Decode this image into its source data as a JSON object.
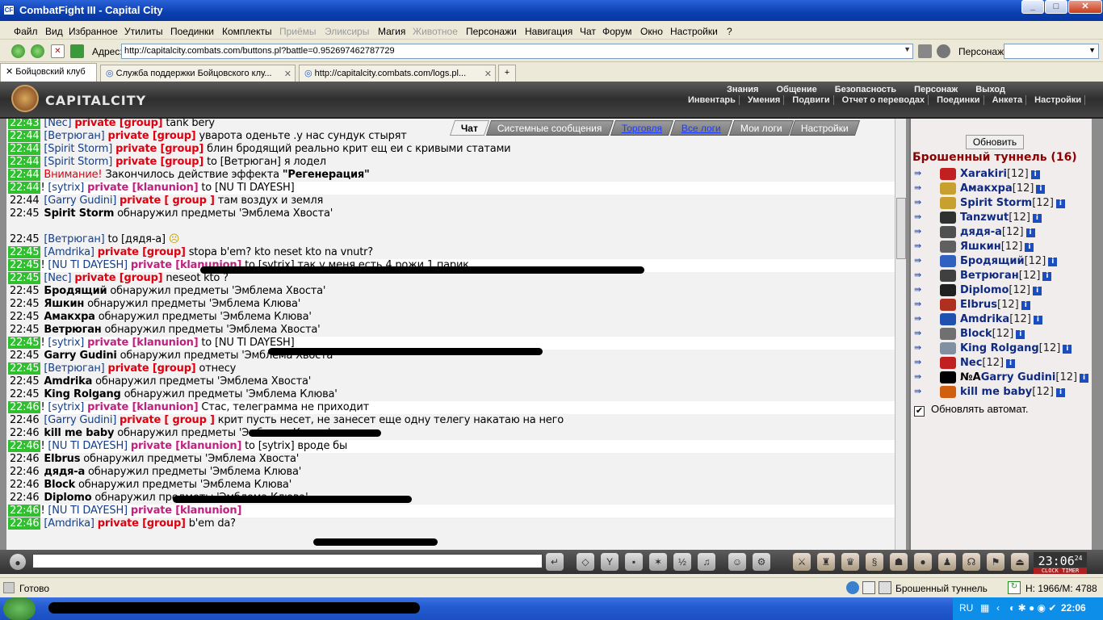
{
  "window": {
    "title": "CombatFight III - Capital City"
  },
  "menu": {
    "items": [
      "Файл",
      "Вид",
      "Избранное",
      "Утилиты",
      "Поединки",
      "Комплекты",
      "Приёмы",
      "Эликсиры",
      "Магия",
      "Животное",
      "Персонажи",
      "Навигация",
      "Чат",
      "Форум",
      "Окно",
      "Настройки",
      "?"
    ]
  },
  "address": {
    "label": "Адрес:",
    "url": "http://capitalcity.combats.com/buttons.pl?battle=0.952697462787729",
    "person_label": "Персонаж:"
  },
  "tabs": [
    {
      "label": "Бойцовский клуб"
    },
    {
      "label": "Служба поддержки Бойцовского клу..."
    },
    {
      "label": "http://capitalcity.combats.com/logs.pl..."
    }
  ],
  "game": {
    "logo_text": "CAPITALCITY",
    "top_menu": [
      "Знания",
      "Общение",
      "Безопасность",
      "Персонаж",
      "Выход"
    ],
    "sub_menu": [
      "Инвентарь",
      "Умения",
      "Подвиги",
      "Отчет о переводах",
      "Поединки",
      "Анкета",
      "Настройки"
    ],
    "chat_tabs": [
      "Чат",
      "Системные сообщения",
      "Торговля",
      "Все логи",
      "Мои логи",
      "Настройки"
    ]
  },
  "chat": {
    "lines": [
      {
        "time": "22:43",
        "hl": true,
        "w": false,
        "n": "[Nec]",
        "p": "private [group]",
        "m": "tank bery"
      },
      {
        "time": "22:44",
        "hl": true,
        "w": false,
        "n": "[Ветрюган]",
        "p": "private [group]",
        "m": "уварота оденьте .у нас сундук стырят"
      },
      {
        "time": "22:44",
        "hl": true,
        "w": false,
        "n": "[Spirit Storm]",
        "p": "private [group]",
        "m": "блин бродящий реально крит ещ еи с кривыми статами"
      },
      {
        "time": "22:44",
        "hl": true,
        "w": false,
        "n": "[Spirit Storm]",
        "p": "private [group]",
        "m": "to [Ветрюган] я лодел"
      },
      {
        "time": "22:44",
        "hl": true,
        "w": false,
        "warn": "Внимание!",
        "m": "Закончилось действие эффекта ",
        "mb": "\"Регенерация\""
      },
      {
        "time": "22:44",
        "hl": true,
        "w": true,
        "x": "!",
        "n": "[sytrix]",
        "pk": "private [klanunion]",
        "m": "to [NU TI DAYESH]"
      },
      {
        "time": "22:44",
        "hl": false,
        "w": false,
        "n": "[Garry Gudini]",
        "p": "private [ group ]",
        "m": "там воздух и земля"
      },
      {
        "time": "22:45",
        "hl": false,
        "w": false,
        "b": "Spirit Storm",
        "m": "обнаружил предметы 'Эмблема Хвоста'"
      },
      {
        "time": "",
        "hl": false,
        "w": false,
        "m": ""
      },
      {
        "time": "22:45",
        "hl": false,
        "w": false,
        "n": "[Ветрюган]",
        "m": "to [дядя-а]",
        "smile": true
      },
      {
        "time": "22:45",
        "hl": true,
        "w": false,
        "n": "[Amdrika]",
        "p": "private [group]",
        "m": "stopa b'em? kto neset kto na vnutr?"
      },
      {
        "time": "22:45",
        "hl": true,
        "w": true,
        "x": "!",
        "n": "[NU TI DAYESH]",
        "pk": "private [klanunion]",
        "m": "to [sytrix] так у меня есть 4 рожи 1 парик"
      },
      {
        "time": "22:45",
        "hl": true,
        "w": false,
        "n": "[Nec]",
        "p": "private [group]",
        "m": "neseot kto ?"
      },
      {
        "time": "22:45",
        "hl": false,
        "w": false,
        "b": "Бродящий",
        "m": "обнаружил предметы 'Эмблема Хвоста'"
      },
      {
        "time": "22:45",
        "hl": false,
        "w": false,
        "b": "Яшкин",
        "m": "обнаружил предметы 'Эмблема Клюва'"
      },
      {
        "time": "22:45",
        "hl": false,
        "w": false,
        "b": "Амакхра",
        "m": "обнаружил предметы 'Эмблема Клюва'"
      },
      {
        "time": "22:45",
        "hl": false,
        "w": false,
        "b": "Ветрюган",
        "m": "обнаружил предметы 'Эмблема Хвоста'"
      },
      {
        "time": "22:45",
        "hl": true,
        "w": true,
        "x": "!",
        "n": "[sytrix]",
        "pk": "private [klanunion]",
        "m": "to [NU TI DAYESH]"
      },
      {
        "time": "22:45",
        "hl": false,
        "w": false,
        "b": "Garry Gudini",
        "m": "обнаружил предметы 'Эмблема Хвоста'"
      },
      {
        "time": "22:45",
        "hl": true,
        "w": false,
        "n": "[Ветрюган]",
        "p": "private [group]",
        "m": "отнесу"
      },
      {
        "time": "22:45",
        "hl": false,
        "w": false,
        "b": "Amdrika",
        "m": "обнаружил предметы 'Эмблема Хвоста'"
      },
      {
        "time": "22:45",
        "hl": false,
        "w": false,
        "b": "King Rolgang",
        "m": "обнаружил предметы 'Эмблема Клюва'"
      },
      {
        "time": "22:46",
        "hl": true,
        "w": true,
        "x": "!",
        "n": "[sytrix]",
        "pk": "private [klanunion]",
        "m": "Стас, телеграмма не приходит"
      },
      {
        "time": "22:46",
        "hl": false,
        "w": false,
        "n": "[Garry Gudini]",
        "p": "private [ group ]",
        "m": "крит пусть несет, не занесет еще одну телегу накатаю на него"
      },
      {
        "time": "22:46",
        "hl": false,
        "w": false,
        "b": "kill me baby",
        "m": "обнаружил предметы 'Эмблема Клюва'"
      },
      {
        "time": "22:46",
        "hl": true,
        "w": true,
        "x": "!",
        "n": "[NU TI DAYESH]",
        "pk": "private [klanunion]",
        "m": "to [sytrix] вроде бы"
      },
      {
        "time": "22:46",
        "hl": false,
        "w": false,
        "b": "Elbrus",
        "m": "обнаружил предметы 'Эмблема Хвоста'"
      },
      {
        "time": "22:46",
        "hl": false,
        "w": false,
        "b": "дядя-а",
        "m": "обнаружил предметы 'Эмблема Клюва'"
      },
      {
        "time": "22:46",
        "hl": false,
        "w": false,
        "b": "Block",
        "m": "обнаружил предметы 'Эмблема Клюва'"
      },
      {
        "time": "22:46",
        "hl": false,
        "w": false,
        "b": "Diplomo",
        "m": "обнаружил предметы 'Эмблема Клюва'"
      },
      {
        "time": "22:46",
        "hl": true,
        "w": true,
        "x": "!",
        "n": "[NU TI DAYESH]",
        "pk": "private [klanunion]",
        "m": ""
      },
      {
        "time": "22:46",
        "hl": true,
        "w": false,
        "n": "[Amdrika]",
        "p": "private [group]",
        "m": "b'em da?"
      }
    ]
  },
  "panel": {
    "refresh_label": "Обновить",
    "room_title": "Брошенный туннель (16)",
    "players": [
      {
        "name": "Xarakiri",
        "level": "[12]",
        "color": "#c22020"
      },
      {
        "name": "Амакхра",
        "level": "[12]",
        "color": "#c8a030"
      },
      {
        "name": "Spirit Storm",
        "level": "[12]",
        "color": "#c8a030"
      },
      {
        "name": "Tanzwut",
        "level": "[12]",
        "color": "#303030"
      },
      {
        "name": "дядя-а",
        "level": "[12]",
        "color": "#505050"
      },
      {
        "name": "Яшкин",
        "level": "[12]",
        "color": "#606060"
      },
      {
        "name": "Бродящий",
        "level": "[12]",
        "color": "#3060c0"
      },
      {
        "name": "Ветрюган",
        "level": "[12]",
        "color": "#404040"
      },
      {
        "name": "Diplomo",
        "level": "[12]",
        "color": "#202020"
      },
      {
        "name": "Elbrus",
        "level": "[12]",
        "color": "#b03020"
      },
      {
        "name": "Amdrika",
        "level": "[12]",
        "color": "#2050b0"
      },
      {
        "name": "Block",
        "level": "[12]",
        "color": "#707070"
      },
      {
        "name": "King Rolgang",
        "level": "[12]",
        "color": "#8090a0"
      },
      {
        "name": "Nec",
        "level": "[12]",
        "color": "#c02020"
      },
      {
        "name": "Garry Gudini",
        "prefix": "№А",
        "level": "[12]",
        "color": "#000000"
      },
      {
        "name": "kill me baby",
        "level": "[12]",
        "color": "#d06010"
      }
    ],
    "auto_label": "Обновлять автомат."
  },
  "clock": {
    "time": "23:06",
    "sec": "24",
    "label": "CLOCK TIMER"
  },
  "status": {
    "ready": "Готово",
    "location": "Брошенный туннель",
    "hp": "H: 1966/M: 4788"
  },
  "taskbar": {
    "lang": "RU",
    "time": "22:06"
  }
}
